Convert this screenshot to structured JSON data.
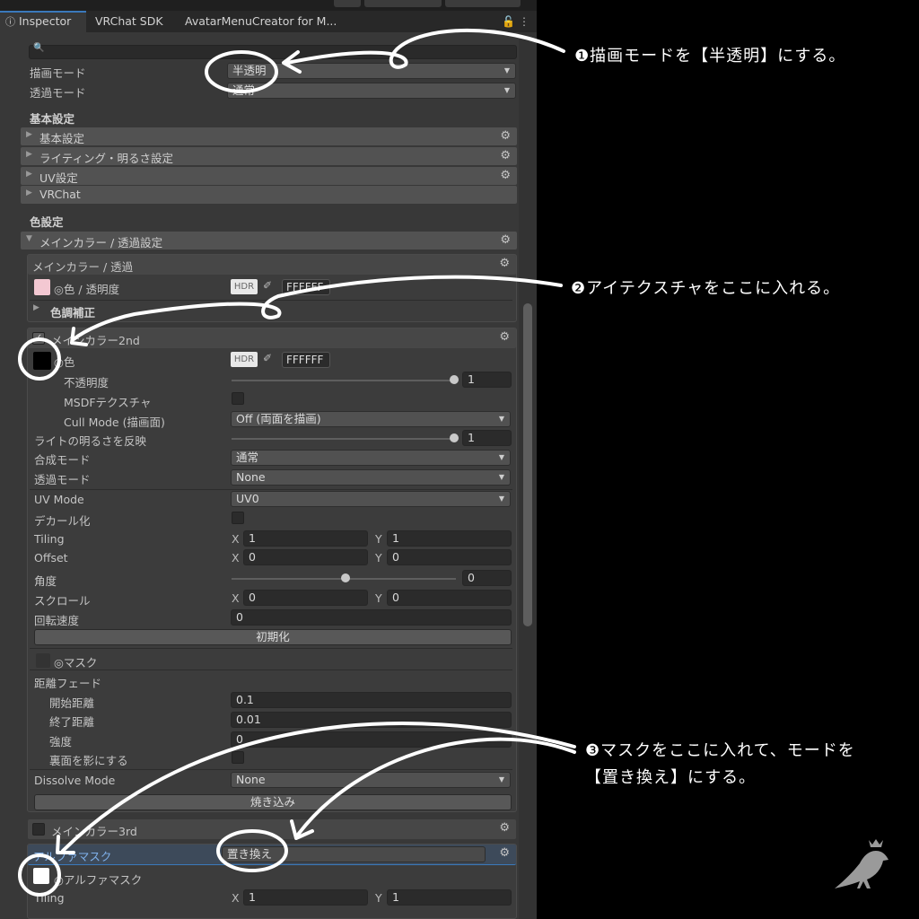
{
  "tabs": [
    "Inspector",
    "VRChat SDK",
    "AvatarMenuCreator for M..."
  ],
  "top": {
    "render_mode_label": "描画モード",
    "render_mode_value": "半透明",
    "trans_mode_label": "透過モード",
    "trans_mode_value": "通常",
    "basic_section": "基本設定",
    "basic_folds": [
      "基本設定",
      "ライティング・明るさ設定",
      "UV設定",
      "VRChat"
    ],
    "color_section": "色設定",
    "main_color_fold": "メインカラー / 透過設定"
  },
  "main_color_box": {
    "header": "メインカラー / 透過",
    "color_label": "◎色 / 透明度",
    "hdr": "HDR",
    "hex": "FFFFFF",
    "tone_label": "色調補正"
  },
  "second": {
    "header": "メインカラー2nd",
    "color_label": "◎色",
    "hdr": "HDR",
    "hex": "FFFFFF",
    "opacity_label": "不透明度",
    "opacity_value": "1",
    "msdf_label": "MSDFテクスチャ",
    "cull_label": "Cull Mode (描画面)",
    "cull_value": "Off (両面を描画)",
    "light_label": "ライトの明るさを反映",
    "light_value": "1",
    "blend_label": "合成モード",
    "blend_value": "通常",
    "trans_label": "透過モード",
    "trans_value": "None",
    "uv_label": "UV Mode",
    "uv_value": "UV0",
    "decal_label": "デカール化",
    "tiling_label": "Tiling",
    "tiling_x": "1",
    "tiling_y": "1",
    "offset_label": "Offset",
    "offset_x": "0",
    "offset_y": "0",
    "angle_label": "角度",
    "angle_value": "0",
    "scroll_label": "スクロール",
    "scroll_x": "0",
    "scroll_y": "0",
    "rot_label": "回転速度",
    "rot_value": "0",
    "reset_btn": "初期化",
    "mask_label": "◎マスク",
    "fade_label": "距離フェード",
    "fade_start_label": "開始距離",
    "fade_start": "0.1",
    "fade_end_label": "終了距離",
    "fade_end": "0.01",
    "strength_label": "強度",
    "strength": "0",
    "back_label": "裏面を影にする",
    "dissolve_label": "Dissolve Mode",
    "dissolve_value": "None",
    "bake_btn": "焼き込み"
  },
  "third": {
    "header": "メインカラー3rd"
  },
  "alpha": {
    "header": "アルファマスク",
    "mode_value": "置き換え",
    "mask_label": "◎アルファマスク",
    "tiling_label": "Tiling",
    "tiling_x": "1",
    "tiling_y": "1"
  },
  "xy": {
    "x": "X",
    "y": "Y"
  },
  "notes": {
    "n1": "❶描画モードを【半透明】にする。",
    "n2": "❷アイテクスチャをここに入れる。",
    "n3a": "❸マスクをここに入れて、モードを",
    "n3b": "【置き換え】にする。"
  },
  "colors": {
    "panel": "#383838",
    "accent": "#3a79bb",
    "annotation": "#ffffff"
  }
}
